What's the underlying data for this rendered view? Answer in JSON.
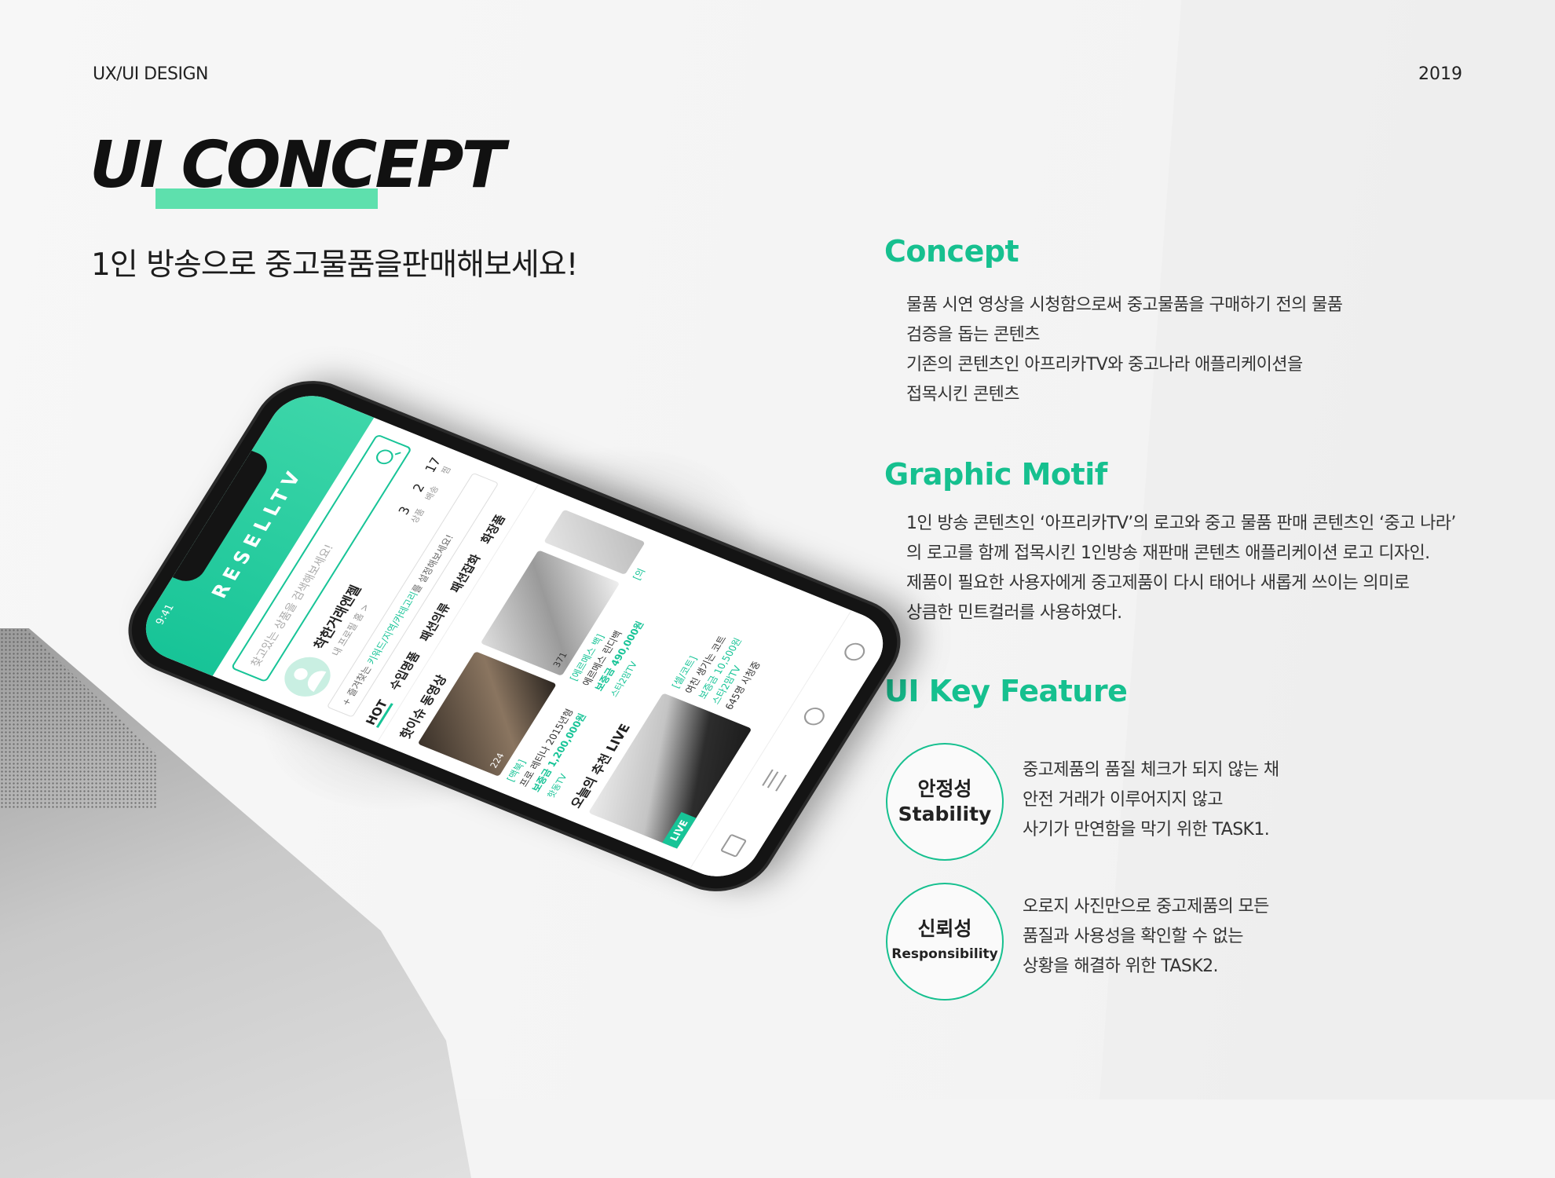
{
  "header": {
    "label": "UX/UI DESIGN",
    "year": "2019"
  },
  "title": "UI CONCEPT",
  "subtitle": "1인 방송으로 중고물품을판매해보세요!",
  "sections": {
    "concept": {
      "heading": "Concept",
      "lines": [
        "물품 시연 영상을 시청함으로써 중고물품을 구매하기 전의 물품",
        "검증을 돕는 콘텐츠",
        "기존의 콘텐츠인 아프리카TV와 중고나라 애플리케이션을",
        "접목시킨 콘텐츠"
      ]
    },
    "motif": {
      "heading": "Graphic Motif",
      "lines": [
        "1인 방송 콘텐츠인 ‘아프리카TV’의 로고와 중고 물품 판매 콘텐츠인 ‘중고 나라’",
        "의 로고를 함께 접목시킨 1인방송 재판매 콘텐츠 애플리케이션 로고 디자인.",
        "제품이 필요한 사용자에게 중고제품이 다시 태어나 새롭게 쓰이는 의미로",
        "상큼한 민트컬러를 사용하였다."
      ]
    },
    "features": {
      "heading": "UI Key Feature",
      "items": [
        {
          "ko": "안정성",
          "en": "Stability",
          "lines": [
            "중고제품의 품질 체크가 되지 않는 채",
            "안전 거래가 이루어지지 않고",
            "사기가 만연함을 막기 위한 TASK1."
          ]
        },
        {
          "ko": "신뢰성",
          "en": "Responsibility",
          "lines": [
            "오로지 사진만으로 중고제품의 모든",
            "품질과 사용성을 확인할 수 없는",
            "상황을 해결하 위한 TASK2."
          ]
        }
      ]
    }
  },
  "phone": {
    "time": "9:41",
    "logo": "RESELLTV",
    "search_placeholder": "찾고있는 상품을 검색해보세요!",
    "profile": {
      "name": "착한거래엔젤",
      "sub": "내 프로필 홈 >"
    },
    "stats": [
      {
        "num": "3",
        "label": "상품"
      },
      {
        "num": "2",
        "label": "배송"
      },
      {
        "num": "17",
        "label": "찜"
      }
    ],
    "fav": {
      "prefix": "+ 즐겨찾는 ",
      "highlight": "키워드/지역/카테고리",
      "suffix": "를 설정해보세요!"
    },
    "tabs": [
      "HOT",
      "수입명품",
      "패션의류",
      "패션잡화",
      "화장품"
    ],
    "hot_title": "핫이슈 동영상",
    "cards": [
      {
        "views": "224",
        "tag": "[맥북]",
        "title": "프로 레티나 2015년형",
        "price": "보증금 1,200,000원",
        "channel": "핫동TV"
      },
      {
        "views": "371",
        "tag": "[에르메스 백]",
        "title": "에르메스 린디백",
        "price": "보증금 490,000원",
        "channel": "스타2맘TV"
      },
      {
        "views": "",
        "tag": "[의",
        "title": "",
        "price": "",
        "channel": ""
      }
    ],
    "live_title": "오늘의 추천 LIVE",
    "live": {
      "badge": "LIVE",
      "tag": "[셀/코트]",
      "title": "여친 생기는 코트",
      "price": "보증금 10,500원",
      "channel": "스타2맘TV",
      "viewers": "645명 시청중"
    }
  },
  "colors": {
    "accent": "#16c08f",
    "title_underline": "#5ee0ad"
  }
}
